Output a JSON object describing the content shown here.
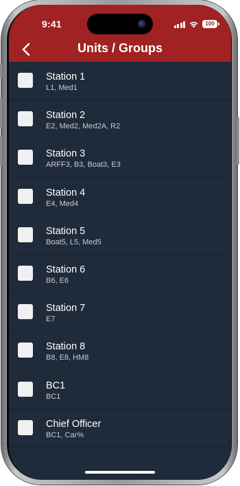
{
  "status_bar": {
    "time": "9:41",
    "battery": "100",
    "icons": [
      "cellular-signal-icon",
      "wifi-icon",
      "battery-icon"
    ]
  },
  "nav": {
    "title": "Units / Groups",
    "back_icon": "chevron-left-icon"
  },
  "colors": {
    "header": "#a02222",
    "background": "#1f2b3a",
    "checkbox": "#f0f0f0"
  },
  "groups": [
    {
      "title": "Station 1",
      "units": "L1, Med1",
      "checked": false
    },
    {
      "title": "Station 2",
      "units": "E2, Med2, Med2A, R2",
      "checked": false
    },
    {
      "title": "Station 3",
      "units": "ARFF3, B3, Boat3, E3",
      "checked": false
    },
    {
      "title": "Station 4",
      "units": "E4, Med4",
      "checked": false
    },
    {
      "title": "Station 5",
      "units": "Boat5, L5, Med5",
      "checked": false
    },
    {
      "title": "Station 6",
      "units": "B6, E6",
      "checked": false
    },
    {
      "title": "Station 7",
      "units": "E7",
      "checked": false
    },
    {
      "title": "Station 8",
      "units": "B8, E8, HM8",
      "checked": false
    },
    {
      "title": "BC1",
      "units": "BC1",
      "checked": false
    },
    {
      "title": "Chief Officer",
      "units": "BC1, Car%",
      "checked": false
    }
  ]
}
